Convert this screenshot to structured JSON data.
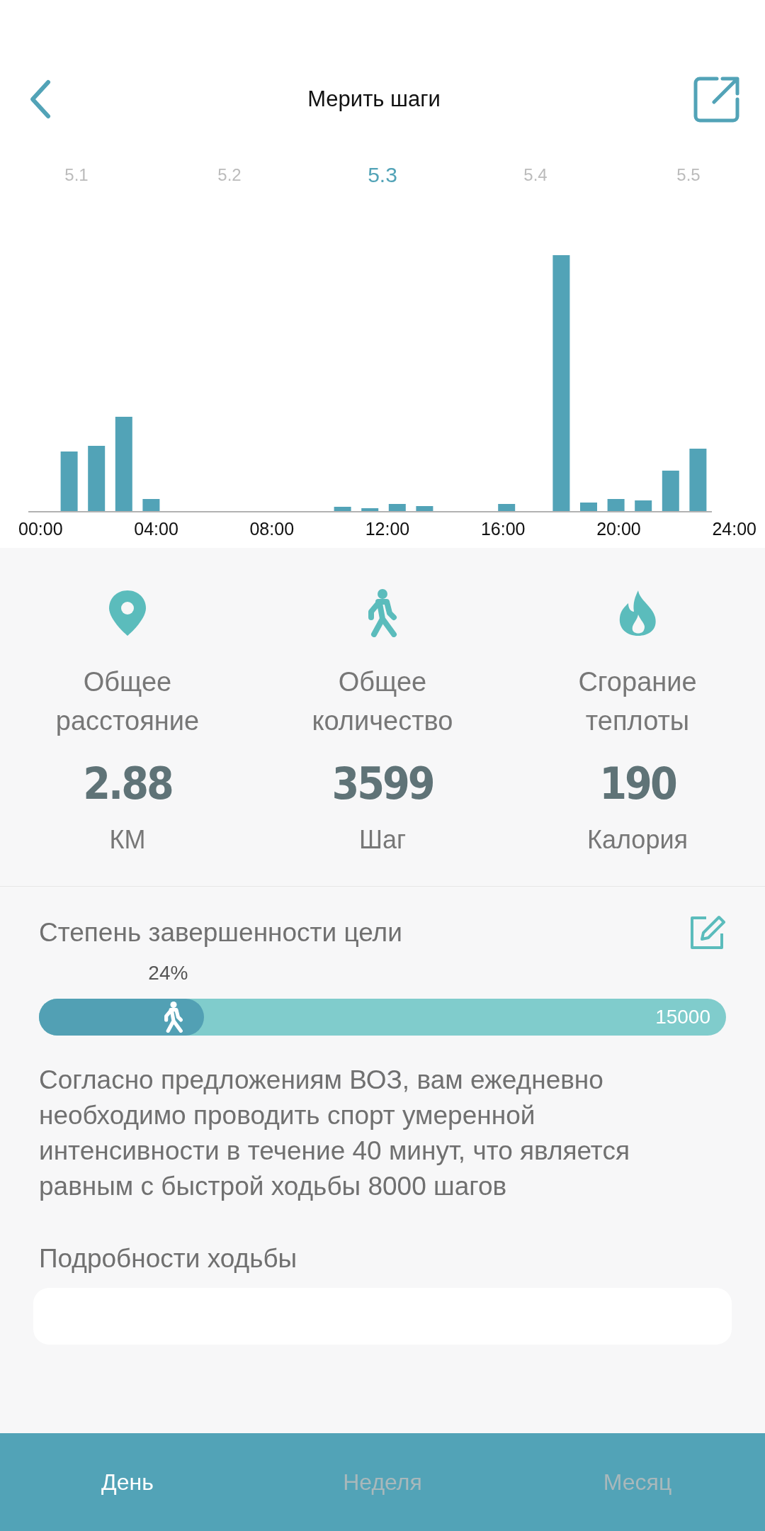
{
  "header": {
    "title": "Мерить шаги"
  },
  "date_tabs": [
    {
      "label": "5.1",
      "selected": false
    },
    {
      "label": "5.2",
      "selected": false
    },
    {
      "label": "5.3",
      "selected": true
    },
    {
      "label": "5.4",
      "selected": false
    },
    {
      "label": "5.5",
      "selected": false
    }
  ],
  "chart": {
    "x_labels": [
      "00:00",
      "04:00",
      "08:00",
      "12:00",
      "16:00",
      "20:00",
      "24:00"
    ]
  },
  "stats": [
    {
      "kind": "distance",
      "label": "Общее расстояние",
      "value": "2.88",
      "unit": "КМ"
    },
    {
      "kind": "steps",
      "label": "Общее количество",
      "value": "3599",
      "unit": "Шаг"
    },
    {
      "kind": "calories",
      "label": "Сгорание теплоты",
      "value": "190",
      "unit": "Калория"
    }
  ],
  "goal": {
    "title": "Степень завершенности цели",
    "percent": "24%",
    "level": 0.24,
    "target": "15000",
    "note": "Согласно предложениям ВОЗ, вам ежедневно необходимо проводить спорт умеренной интенсивности в течение 40 минут, что является равным с быстрой ходьбы 8000 шагов"
  },
  "details": {
    "title": "Подробности ходьбы"
  },
  "bottom_tabs": [
    {
      "label": "День",
      "selected": true
    },
    {
      "label": "Неделя",
      "selected": false
    },
    {
      "label": "Месяц",
      "selected": false
    }
  ]
}
